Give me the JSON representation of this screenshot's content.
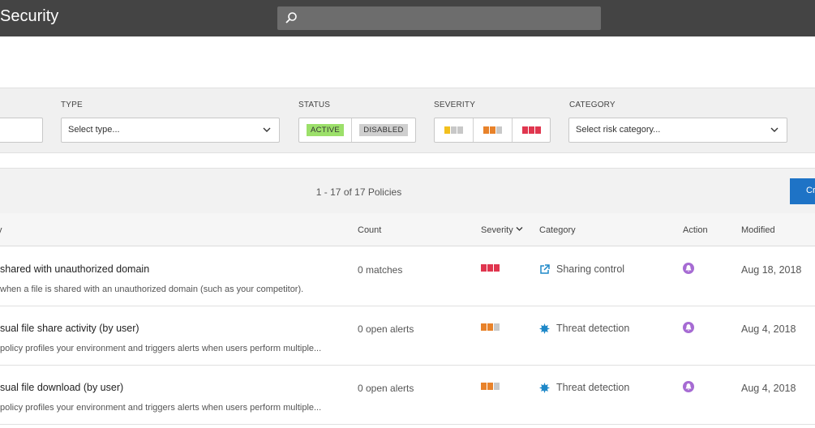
{
  "header": {
    "title": "Security",
    "search_placeholder": ""
  },
  "filters": {
    "type_label": "TYPE",
    "type_placeholder": "Select type...",
    "status_label": "STATUS",
    "status_active": "ACTIVE",
    "status_disabled": "DISABLED",
    "severity_label": "SEVERITY",
    "category_label": "CATEGORY",
    "category_placeholder": "Select risk category..."
  },
  "toolbar": {
    "count_text": "1 - 17 of 17 Policies",
    "create_label": "Create"
  },
  "table": {
    "headers": {
      "policy": "y",
      "count": "Count",
      "severity": "Severity",
      "category": "Category",
      "action": "Action",
      "modified": "Modified"
    },
    "rows": [
      {
        "name": "shared with unauthorized domain",
        "description": "when a file is shared with an unauthorized domain (such as your competitor).",
        "count": "0 matches",
        "severity": "high",
        "category": "Sharing control",
        "category_icon": "share-icon",
        "modified": "Aug 18, 2018"
      },
      {
        "name": "sual file share activity (by user)",
        "description": "policy profiles your environment and triggers alerts when users perform multiple...",
        "count": "0 open alerts",
        "severity": "medium",
        "category": "Threat detection",
        "category_icon": "threat-burst-icon",
        "modified": "Aug 4, 2018"
      },
      {
        "name": "sual file download (by user)",
        "description": "policy profiles your environment and triggers alerts when users perform multiple...",
        "count": "0 open alerts",
        "severity": "medium",
        "category": "Threat detection",
        "category_icon": "threat-burst-icon",
        "modified": "Aug 4, 2018"
      }
    ]
  },
  "colors": {
    "topbar": "#444444",
    "accent_blue": "#1e73c6",
    "sev_low": "#f2c01e",
    "sev_medium": "#e8822a",
    "sev_high": "#e0364f",
    "sev_off": "#c8c8c8",
    "action_purple": "#a66bd3",
    "category_icon": "#1e88c8"
  }
}
